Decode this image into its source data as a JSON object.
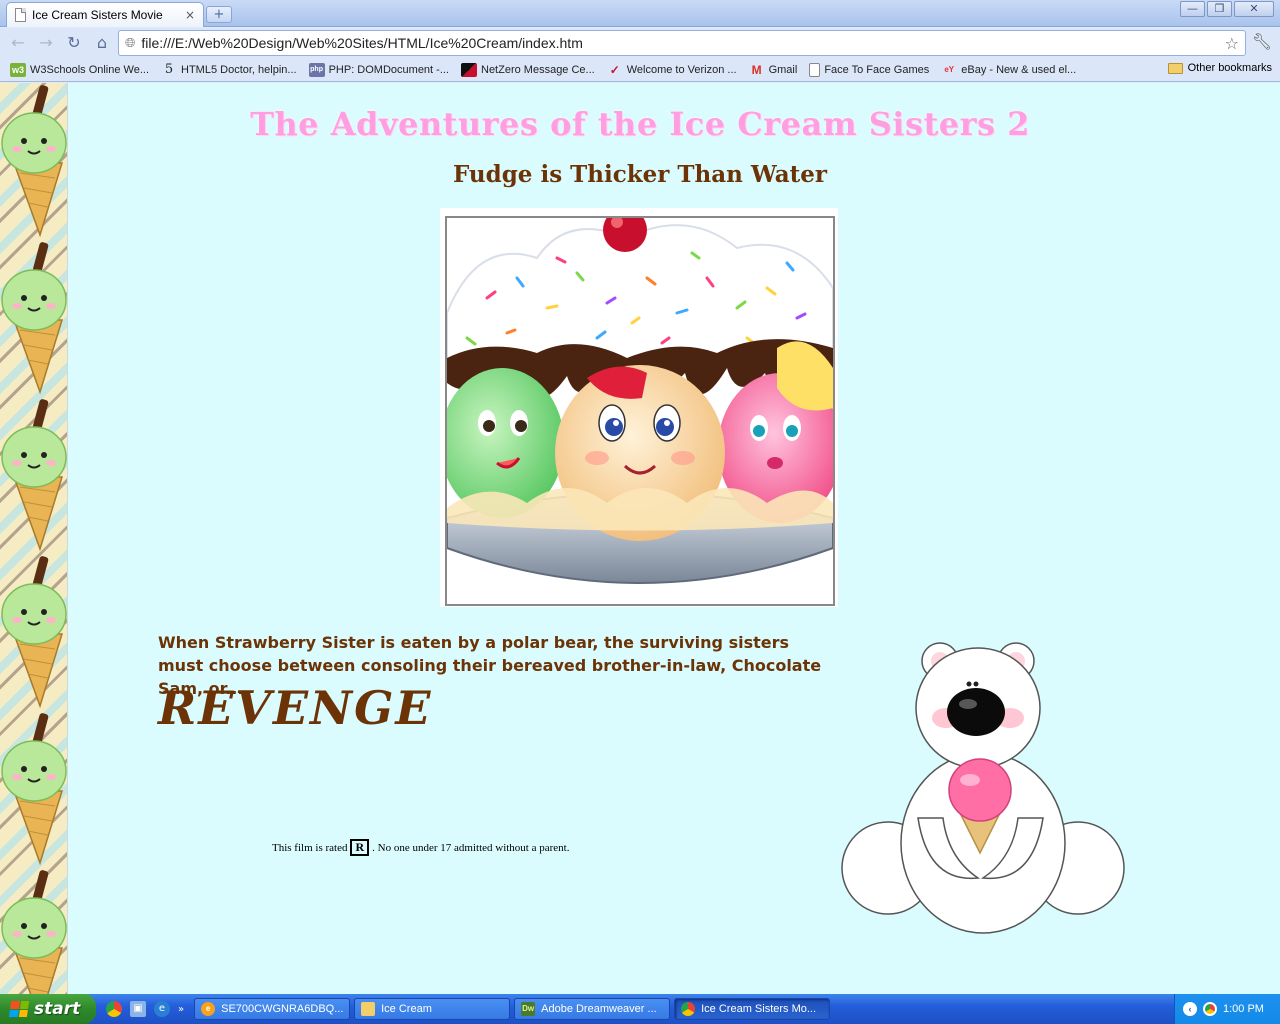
{
  "browser": {
    "tab_title": "Ice Cream Sisters Movie",
    "tab_close": "×",
    "new_tab": "+",
    "url": "file:///E:/Web%20Design/Web%20Sites/HTML/Ice%20Cream/index.htm",
    "window_buttons": {
      "minimize": "—",
      "maximize": "❐",
      "close": "✕"
    },
    "nav": {
      "back": "←",
      "forward": "→",
      "reload": "↻",
      "home": "⌂"
    },
    "bookmarks": [
      {
        "label": "W3Schools Online We...",
        "icon": "w3schools-icon",
        "favtext": "w3",
        "color": "#7ab33a"
      },
      {
        "label": "HTML5 Doctor, helpin...",
        "icon": "html5doctor-icon",
        "favtext": "5",
        "color": "#ffffff"
      },
      {
        "label": "PHP: DOMDocument -...",
        "icon": "php-icon",
        "favtext": "php",
        "color": "#6c74a8"
      },
      {
        "label": "NetZero Message Ce...",
        "icon": "netzero-icon",
        "favtext": "",
        "color": "#c8102e"
      },
      {
        "label": "Welcome to Verizon ...",
        "icon": "verizon-icon",
        "favtext": "✓",
        "color": "#ffffff"
      },
      {
        "label": "Gmail",
        "icon": "gmail-icon",
        "favtext": "M",
        "color": "#ffffff"
      },
      {
        "label": "Face To Face Games",
        "icon": "page-icon",
        "favtext": "",
        "color": "#ffffff"
      },
      {
        "label": "eBay - New & used el...",
        "icon": "ebay-icon",
        "favtext": "eY",
        "color": "#ffffff"
      }
    ],
    "other_bookmarks": "Other bookmarks"
  },
  "page": {
    "title": "The Adventures of the Ice Cream Sisters 2",
    "subtitle": "Fudge is Thicker Than Water",
    "tagline": "When Strawberry Sister is eaten by a polar bear, the surviving sisters must choose between consoling their bereaved brother-in-law, Chocolate Sam, or...",
    "revenge": "REVENGE",
    "rating_prefix": "This film is rated",
    "rating": "R",
    "rating_suffix": ". No one under 17 admitted without a parent.",
    "colors": {
      "background": "#dbfcfe",
      "title": "#ff9ee0",
      "brown": "#6b3306"
    }
  },
  "taskbar": {
    "start_label": "start",
    "items": [
      {
        "label": "SE700CWGNRA6DBQ...",
        "icon": "ie-icon",
        "active": false
      },
      {
        "label": "Ice Cream",
        "icon": "folder-icon",
        "active": false
      },
      {
        "label": "Adobe Dreamweaver ...",
        "icon": "dreamweaver-icon",
        "active": false
      },
      {
        "label": "Ice Cream Sisters Mo...",
        "icon": "chrome-icon",
        "active": true
      }
    ],
    "clock": "1:00 PM"
  }
}
